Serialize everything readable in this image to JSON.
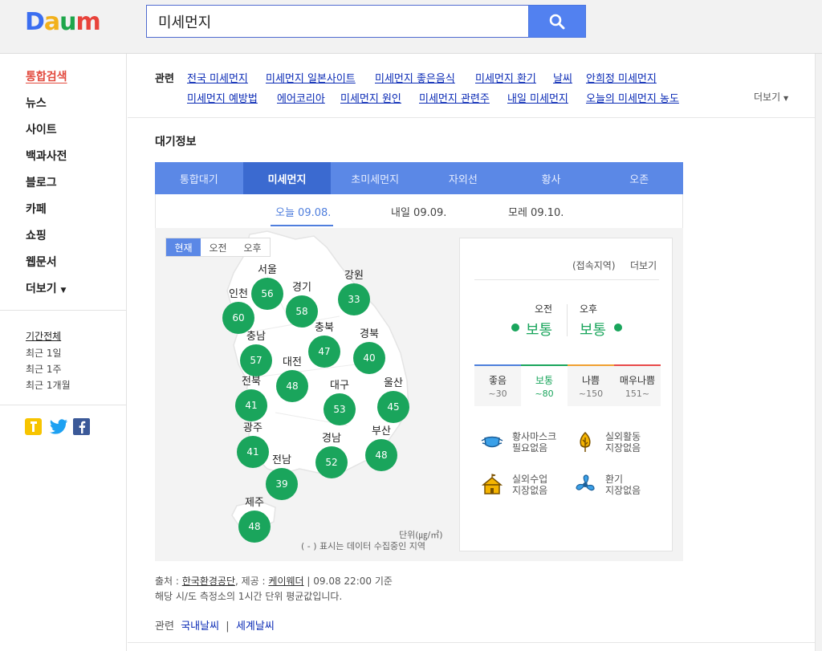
{
  "logo": {
    "letters": [
      "D",
      "a",
      "u",
      "m"
    ],
    "colors": [
      "#3b6ef0",
      "#f2b11c",
      "#1ea64b",
      "#e8433b"
    ]
  },
  "search": {
    "value": "미세먼지",
    "button_icon": "search-icon"
  },
  "nav": {
    "items": [
      "통합검색",
      "뉴스",
      "사이트",
      "백과사전",
      "블로그",
      "카페",
      "쇼핑",
      "웹문서",
      "더보기"
    ],
    "active": 0
  },
  "period": {
    "items": [
      "기간전체",
      "최근 1일",
      "최근 1주",
      "최근 1개월"
    ],
    "active": 0
  },
  "social": [
    "kakaostory-icon",
    "twitter-icon",
    "facebook-icon"
  ],
  "related": {
    "label": "관련",
    "row1": [
      "전국 미세먼지",
      "미세먼지 일본사이트",
      "미세먼지 좋은음식",
      "미세먼지 환기",
      "날씨",
      "안희정 미세먼지"
    ],
    "row2": [
      "미세먼지 예방법",
      "에어코리아",
      "미세먼지 원인",
      "미세먼지 관련주",
      "내일 미세먼지",
      "오늘의 미세먼지 농도"
    ],
    "more": "더보기"
  },
  "air": {
    "title": "대기정보",
    "tabs": [
      "통합대기",
      "미세먼지",
      "초미세먼지",
      "자외선",
      "황사",
      "오존"
    ],
    "active_tab": 1,
    "days": [
      "오늘 09.08.",
      "내일 09.09.",
      "모레 09.10."
    ],
    "active_day": 0,
    "time_toggle": [
      "현재",
      "오전",
      "오후"
    ],
    "active_time": 0,
    "regions": [
      {
        "name": "서울",
        "value": "56"
      },
      {
        "name": "강원",
        "value": "33"
      },
      {
        "name": "인천",
        "value": "60"
      },
      {
        "name": "경기",
        "value": "58"
      },
      {
        "name": "충남",
        "value": "57"
      },
      {
        "name": "충북",
        "value": "47"
      },
      {
        "name": "경북",
        "value": "40"
      },
      {
        "name": "대전",
        "value": "48"
      },
      {
        "name": "전북",
        "value": "41"
      },
      {
        "name": "대구",
        "value": "53"
      },
      {
        "name": "울산",
        "value": "45"
      },
      {
        "name": "광주",
        "value": "41"
      },
      {
        "name": "경남",
        "value": "52"
      },
      {
        "name": "부산",
        "value": "48"
      },
      {
        "name": "전남",
        "value": "39"
      },
      {
        "name": "제주",
        "value": "48"
      }
    ],
    "unit": "단위(㎍/㎥)",
    "collecting_note": "( - ) 표시는 데이터 수집중인 지역",
    "panel": {
      "region": "(접속지역)",
      "more": "더보기",
      "am_label": "오전",
      "am_status": "보통",
      "pm_label": "오후",
      "pm_status": "보통",
      "grades": [
        {
          "name": "좋음",
          "range": "~30",
          "color": "#4d7fdc"
        },
        {
          "name": "보통",
          "range": "~80",
          "color": "#1aa55c"
        },
        {
          "name": "나쁨",
          "range": "~150",
          "color": "#f0a030"
        },
        {
          "name": "매우나쁨",
          "range": "151~",
          "color": "#e84a4a"
        }
      ],
      "current_grade": 1,
      "advice": [
        {
          "icon": "mask-icon",
          "line1": "황사마스크",
          "line2": "필요없음"
        },
        {
          "icon": "tree-icon",
          "line1": "실외활동",
          "line2": "지장없음"
        },
        {
          "icon": "school-icon",
          "line1": "실외수업",
          "line2": "지장없음"
        },
        {
          "icon": "fan-icon",
          "line1": "환기",
          "line2": "지장없음"
        }
      ]
    }
  },
  "source": {
    "prefix": "출처 : ",
    "org": "한국환경공단",
    "mid": ", 제공 : ",
    "provider": "케이웨더",
    "time": " | 09.08 22:00 기준",
    "note": "해당 시/도 측정소의 1시간 단위 평균값입니다."
  },
  "bottom_related": {
    "label": "관련",
    "links": [
      "국내날씨",
      "세계날씨"
    ]
  }
}
